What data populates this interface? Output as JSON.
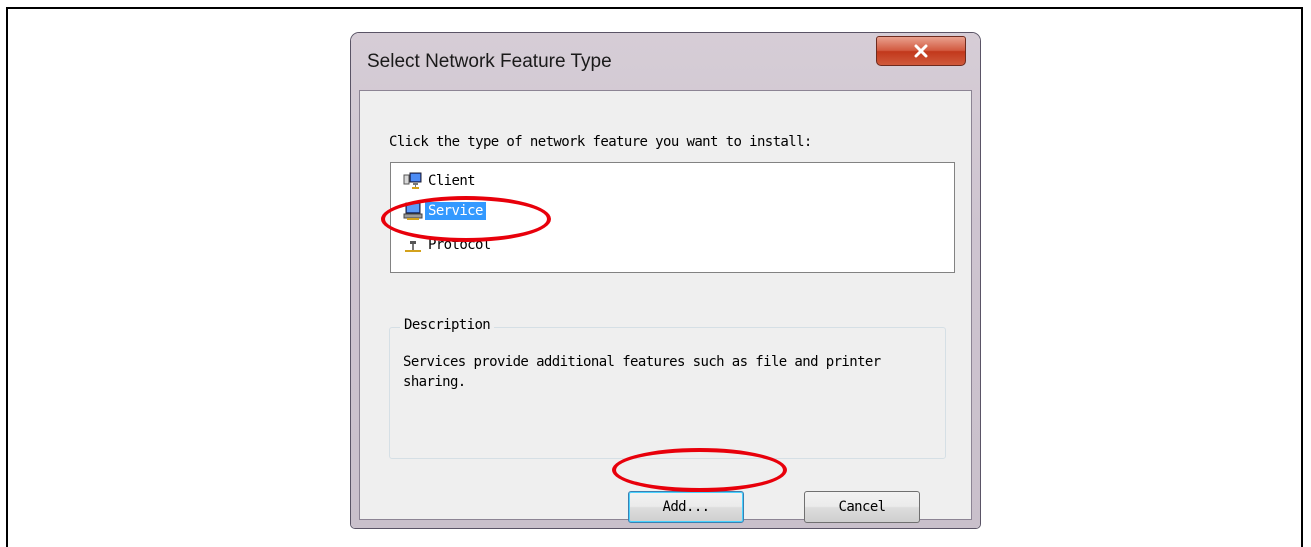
{
  "dialog": {
    "title": "Select Network Feature Type",
    "close_icon": "close-x-icon",
    "prompt": "Click the type of network feature you want to install:",
    "items": [
      {
        "label": "Client",
        "icon": "network-client-icon",
        "selected": false
      },
      {
        "label": "Service",
        "icon": "network-service-icon",
        "selected": true
      },
      {
        "label": "Protocol",
        "icon": "network-protocol-icon",
        "selected": false
      }
    ],
    "description": {
      "legend": "Description",
      "text": "Services provide additional features such as file and printer sharing."
    },
    "buttons": {
      "add": "Add...",
      "cancel": "Cancel"
    }
  },
  "colors": {
    "selection": "#3399ff",
    "annotation": "#e8000b",
    "close_button": "#c2381c"
  }
}
